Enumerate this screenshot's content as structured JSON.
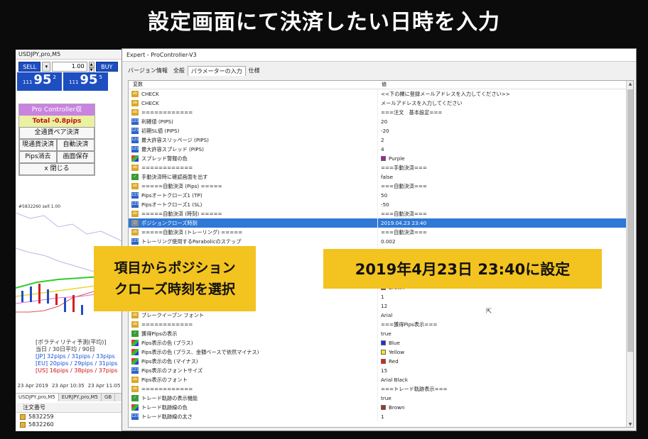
{
  "header": {
    "title": "設定画面にて決済したい日時を入力"
  },
  "mt4": {
    "chart_title": "USDJPY,pro,M5",
    "sell_label": "SELL",
    "buy_label": "BUY",
    "lot": "1.00",
    "bid": {
      "prefix": "111",
      "big": "95",
      "sup": "2"
    },
    "ask": {
      "prefix": "111",
      "big": "95",
      "sup": "5"
    },
    "panel": {
      "title": "Pro Controller収",
      "total": "Total  -0.8pips",
      "all_close": "全通貨ペア決済",
      "current_close": "現通貨決済",
      "auto_close": "自動決済",
      "pips_delete": "Pips消去",
      "screen_save": "画面保存",
      "close": "x 閉じる"
    },
    "chart_label": "#5832260 sell 1.00",
    "info": {
      "line1": "[ボラティリティ予測(平均)]",
      "line2": "当日 / 30日平均 / 90日",
      "line3": "[JP]  32pips / 31pips / 33pips",
      "line4": "[EU]  20pips / 29pips / 31pips",
      "line5": "[US]  16pips / 38pips / 37pips"
    },
    "time_labels": [
      "23 Apr 2019",
      "23 Apr 10:35",
      "23 Apr 11:05"
    ],
    "tabs": [
      "USDJPY,pro,M5",
      "EURJPY,pro,M5",
      "GB"
    ],
    "orders_header": "注文番号",
    "orders": [
      "5832259",
      "5832260"
    ]
  },
  "dialog": {
    "title": "Expert - ProController-V3",
    "tabs": [
      "バージョン情報",
      "全般",
      "パラメーターの入力",
      "仕様"
    ],
    "active_tab": 2,
    "col_var": "変数",
    "col_val": "値",
    "rows": [
      {
        "icon": "ab",
        "name": "CHECK",
        "value": "<<下の欄に登録メールアドレスを入力してください>>"
      },
      {
        "icon": "ab",
        "name": "CHECK",
        "value": "メールアドレスを入力してください"
      },
      {
        "icon": "ab",
        "name": "============",
        "value": "===注文　基本設定==="
      },
      {
        "icon": "num",
        "name": "利確値 (PIPS)",
        "value": "20"
      },
      {
        "icon": "num",
        "name": "初期SL値 (PIPS)",
        "value": "-20"
      },
      {
        "icon": "num",
        "name": "最大許容スリッページ (PIPS)",
        "value": "2"
      },
      {
        "icon": "num",
        "name": "最大許容スプレッド (PIPS)",
        "value": "4"
      },
      {
        "icon": "clr",
        "name": "スプレッド警報の色",
        "value": "Purple",
        "color": "#9b2a9b"
      },
      {
        "icon": "ab",
        "name": "============",
        "value": "===手動決済==="
      },
      {
        "icon": "bool",
        "name": "手動決済時に確認画面を出す",
        "value": "false"
      },
      {
        "icon": "ab",
        "name": "=====自動決済 (Pips) =====",
        "value": "===自動決済==="
      },
      {
        "icon": "num",
        "name": "Pipsオートクローズ1 (TP)",
        "value": "50"
      },
      {
        "icon": "num",
        "name": "Pipsオートクローズ1 (SL)",
        "value": "-50"
      },
      {
        "icon": "ab",
        "name": "=====自動決済 (時刻) =====",
        "value": "===自動決済==="
      },
      {
        "icon": "dt",
        "name": "ポジションクローズ時刻",
        "value": "2019.04.23 23:40",
        "selected": true
      },
      {
        "icon": "ab",
        "name": "=====自動決済 (トレーリング) =====",
        "value": "===自動決済==="
      },
      {
        "icon": "num",
        "name": "トレーリング使用するParabolicのステップ",
        "value": "0.002"
      },
      {
        "icon": "num",
        "name": "",
        "value": ""
      },
      {
        "icon": "num",
        "name": "",
        "value": ""
      },
      {
        "icon": "num",
        "name": "",
        "value": ""
      },
      {
        "icon": "ab",
        "name": "",
        "value": "true"
      },
      {
        "icon": "clr",
        "name": "",
        "value": "Brown",
        "color": "#a0392a"
      },
      {
        "icon": "num",
        "name": "",
        "value": "1"
      },
      {
        "icon": "num",
        "name": "",
        "value": "12"
      },
      {
        "icon": "ab",
        "name": "ブレークイーブン フォント",
        "value": "Arial"
      },
      {
        "icon": "ab",
        "name": "============",
        "value": "===獲得Pips表示==="
      },
      {
        "icon": "bool",
        "name": "獲得Pipsの表示",
        "value": "true"
      },
      {
        "icon": "clr",
        "name": "Pips表示の色 (プラス)",
        "value": "Blue",
        "color": "#1a32e0"
      },
      {
        "icon": "clr",
        "name": "Pips表示の色 (プラス、金額ベースで依然マイナス)",
        "value": "Yellow",
        "color": "#f2e81a"
      },
      {
        "icon": "clr",
        "name": "Pips表示の色 (マイナス)",
        "value": "Red",
        "color": "#e02020"
      },
      {
        "icon": "num",
        "name": "Pips表示のフォントサイズ",
        "value": "15"
      },
      {
        "icon": "ab",
        "name": "Pips表示のフォント",
        "value": "Arial Black"
      },
      {
        "icon": "ab",
        "name": "============",
        "value": "===トレード軌跡表示==="
      },
      {
        "icon": "bool",
        "name": "トレード軌跡の表示機能",
        "value": "true"
      },
      {
        "icon": "clr",
        "name": "トレード軌跡線の色",
        "value": "Brown",
        "color": "#a0392a"
      },
      {
        "icon": "num",
        "name": "トレード軌跡線の太さ",
        "value": "1"
      }
    ]
  },
  "callouts": {
    "left_line1": "項目からポジション",
    "left_line2": "クローズ時刻を選択",
    "right": "2019年4月23日 23:40に設定"
  }
}
